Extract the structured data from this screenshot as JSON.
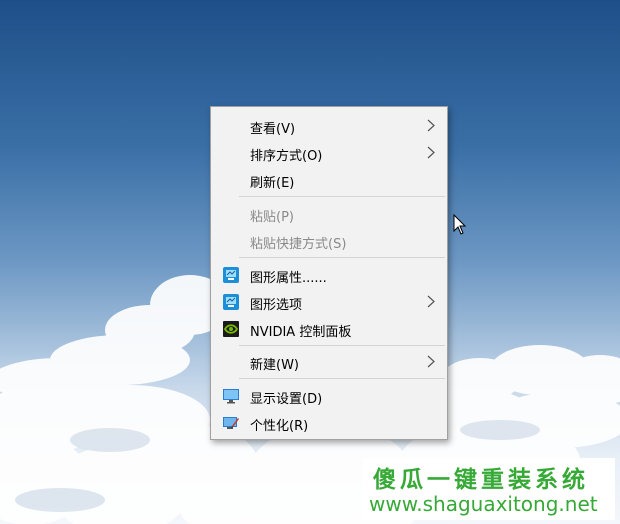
{
  "desktop": {
    "wallpaper": "blue-sky-clouds",
    "colors": {
      "sky_top": "#1f4f88",
      "cloud": "#ffffff",
      "menu_bg": "#f2f2f2",
      "disabled_text": "#8a8a8a",
      "watermark_green": "#36a936"
    }
  },
  "context_menu": {
    "view_label": "查看(V)",
    "sort_label": "排序方式(O)",
    "refresh_label": "刷新(E)",
    "paste_label": "粘贴(P)",
    "paste_shortcut_label": "粘贴快捷方式(S)",
    "graphics_properties_label": "图形属性......",
    "graphics_options_label": "图形选项",
    "nvidia_label": "NVIDIA 控制面板",
    "new_label": "新建(W)",
    "display_settings_label": "显示设置(D)",
    "personalize_label": "个性化(R)",
    "icons": {
      "graphics_properties": "intel-graphics-icon",
      "graphics_options": "intel-graphics-icon",
      "nvidia": "nvidia-icon",
      "display_settings": "monitor-icon",
      "personalize": "personalize-icon"
    }
  },
  "watermark": {
    "title": "傻瓜一键重装系统",
    "url": "www.shaguaxitong.net"
  }
}
